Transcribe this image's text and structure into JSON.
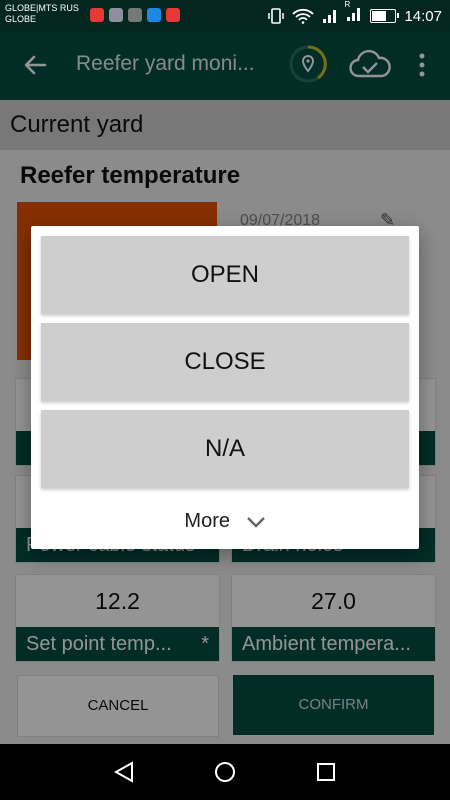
{
  "status_bar": {
    "carrier_line1": "GLOBE|MTS RUS",
    "carrier_line2": "GLOBE",
    "app_icons": [
      {
        "name": "mail-app-icon",
        "color": "#e53935"
      },
      {
        "name": "chat-app-icon",
        "color": "#8e8ea0"
      },
      {
        "name": "gallery-app-icon",
        "color": "#777777"
      },
      {
        "name": "messenger-app-icon",
        "color": "#1e88e5"
      },
      {
        "name": "calendar-app-icon",
        "color": "#e53935"
      }
    ],
    "roaming": "R",
    "time": "14:07"
  },
  "app_bar": {
    "title": "Reefer yard moni...",
    "back_icon": "arrow-left-icon",
    "location_icon": "location-pin-icon",
    "cloud_icon": "cloud-check-icon",
    "menu_icon": "more-vert-icon"
  },
  "page": {
    "section_title": "Current yard",
    "heading": "Reefer temperature",
    "photo_date": "09/07/2018",
    "fields": [
      {
        "value": "",
        "label": ""
      },
      {
        "value": "",
        "label": ""
      },
      {
        "value": "",
        "label": "Power cable status"
      },
      {
        "value": "",
        "label": "Drain holes"
      },
      {
        "value": "12.2",
        "label": "Set point temp...",
        "required": "*"
      },
      {
        "value": "27.0",
        "label": "Ambient tempera..."
      }
    ],
    "cancel_label": "CANCEL",
    "confirm_label": "CONFIRM"
  },
  "dialog": {
    "options": [
      "OPEN",
      "CLOSE",
      "N/A"
    ],
    "more_label": "More"
  },
  "colors": {
    "primary": "#054f42",
    "status_bar": "#03271f",
    "accent_orange": "#e65100",
    "option_bg": "#cecece"
  }
}
